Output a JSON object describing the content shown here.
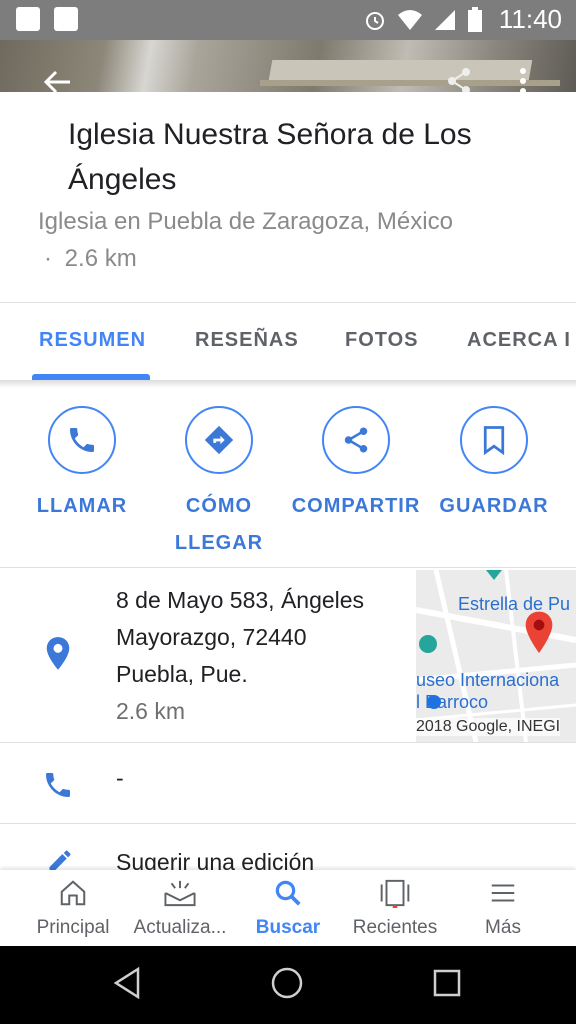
{
  "status_bar": {
    "time": "11:40"
  },
  "place": {
    "title": "Iglesia Nuestra Señora de Los Ángeles",
    "category_location": "Iglesia en Puebla de Zaragoza, México",
    "separator": "·",
    "distance": "2.6 km"
  },
  "tabs": [
    {
      "label": "RESUMEN",
      "active": true
    },
    {
      "label": "RESEÑAS",
      "active": false
    },
    {
      "label": "FOTOS",
      "active": false
    },
    {
      "label": "ACERCA I",
      "active": false
    }
  ],
  "actions": [
    {
      "label": "LLAMAR",
      "icon": "phone-icon"
    },
    {
      "label": "CÓMO LLEGAR",
      "icon": "directions-icon"
    },
    {
      "label": "COMPARTIR",
      "icon": "share-icon"
    },
    {
      "label": "GUARDAR",
      "icon": "bookmark-icon"
    }
  ],
  "address": {
    "line1": "8 de Mayo 583, Ángeles",
    "line2": "Mayorazgo, 72440",
    "line3": "Puebla, Pue.",
    "distance": "2.6 km"
  },
  "map": {
    "label_top": "Estrella de Pu",
    "label_bottom1": "useo Internaciona",
    "label_bottom2": "l Barroco",
    "copyright": "2018 Google, INEGI"
  },
  "phone": {
    "value": "-"
  },
  "suggest": {
    "label": "Sugerir una edición"
  },
  "bottom_nav": [
    {
      "label": "Principal",
      "icon": "home-icon"
    },
    {
      "label": "Actualiza...",
      "icon": "updates-icon"
    },
    {
      "label": "Buscar",
      "icon": "search-icon",
      "active": true
    },
    {
      "label": "Recientes",
      "icon": "recents-icon"
    },
    {
      "label": "Más",
      "icon": "menu-icon"
    }
  ],
  "colors": {
    "accent": "#4285f4",
    "text_primary": "#202124",
    "text_secondary": "#8a8a8a",
    "pin": "#ea4335"
  }
}
